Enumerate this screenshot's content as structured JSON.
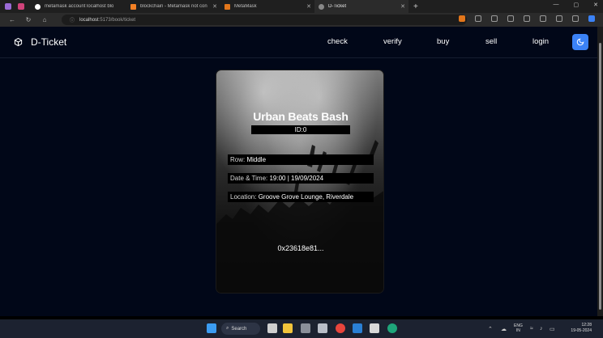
{
  "browser": {
    "tabs": [
      {
        "title": "metamask account localhost blo",
        "icon": "github-icon"
      },
      {
        "title": "blockchain - Metamask not con",
        "icon": "stackoverflow-icon"
      },
      {
        "title": "MetaMask",
        "icon": "metamask-icon"
      },
      {
        "title": "D-Ticket",
        "icon": "dticket-icon",
        "active": true
      }
    ],
    "new_tab": "+",
    "url_host": "localhost",
    "url_path": ":5173/book/ticket"
  },
  "app": {
    "brand": "D-Ticket",
    "nav": [
      "check",
      "verify",
      "buy",
      "sell",
      "login"
    ],
    "accent": "#3b82f6",
    "background": "#010718"
  },
  "ticket": {
    "event_name": "Urban Beats Bash",
    "id_label": "ID:",
    "id_value": "0",
    "row_label": "Row:",
    "row_value": "Middle",
    "datetime_label": "Date & Time:",
    "datetime_value": "19:00 | 19/09/2024",
    "location_label": "Location:",
    "location_value": "Groove Grove Lounge, Riverdale",
    "address": "0x23618e81..."
  },
  "taskbar": {
    "search_label": "Search",
    "lang_top": "ENG",
    "lang_bottom": "IN",
    "time": "12:28",
    "date": "19-05-2024"
  }
}
